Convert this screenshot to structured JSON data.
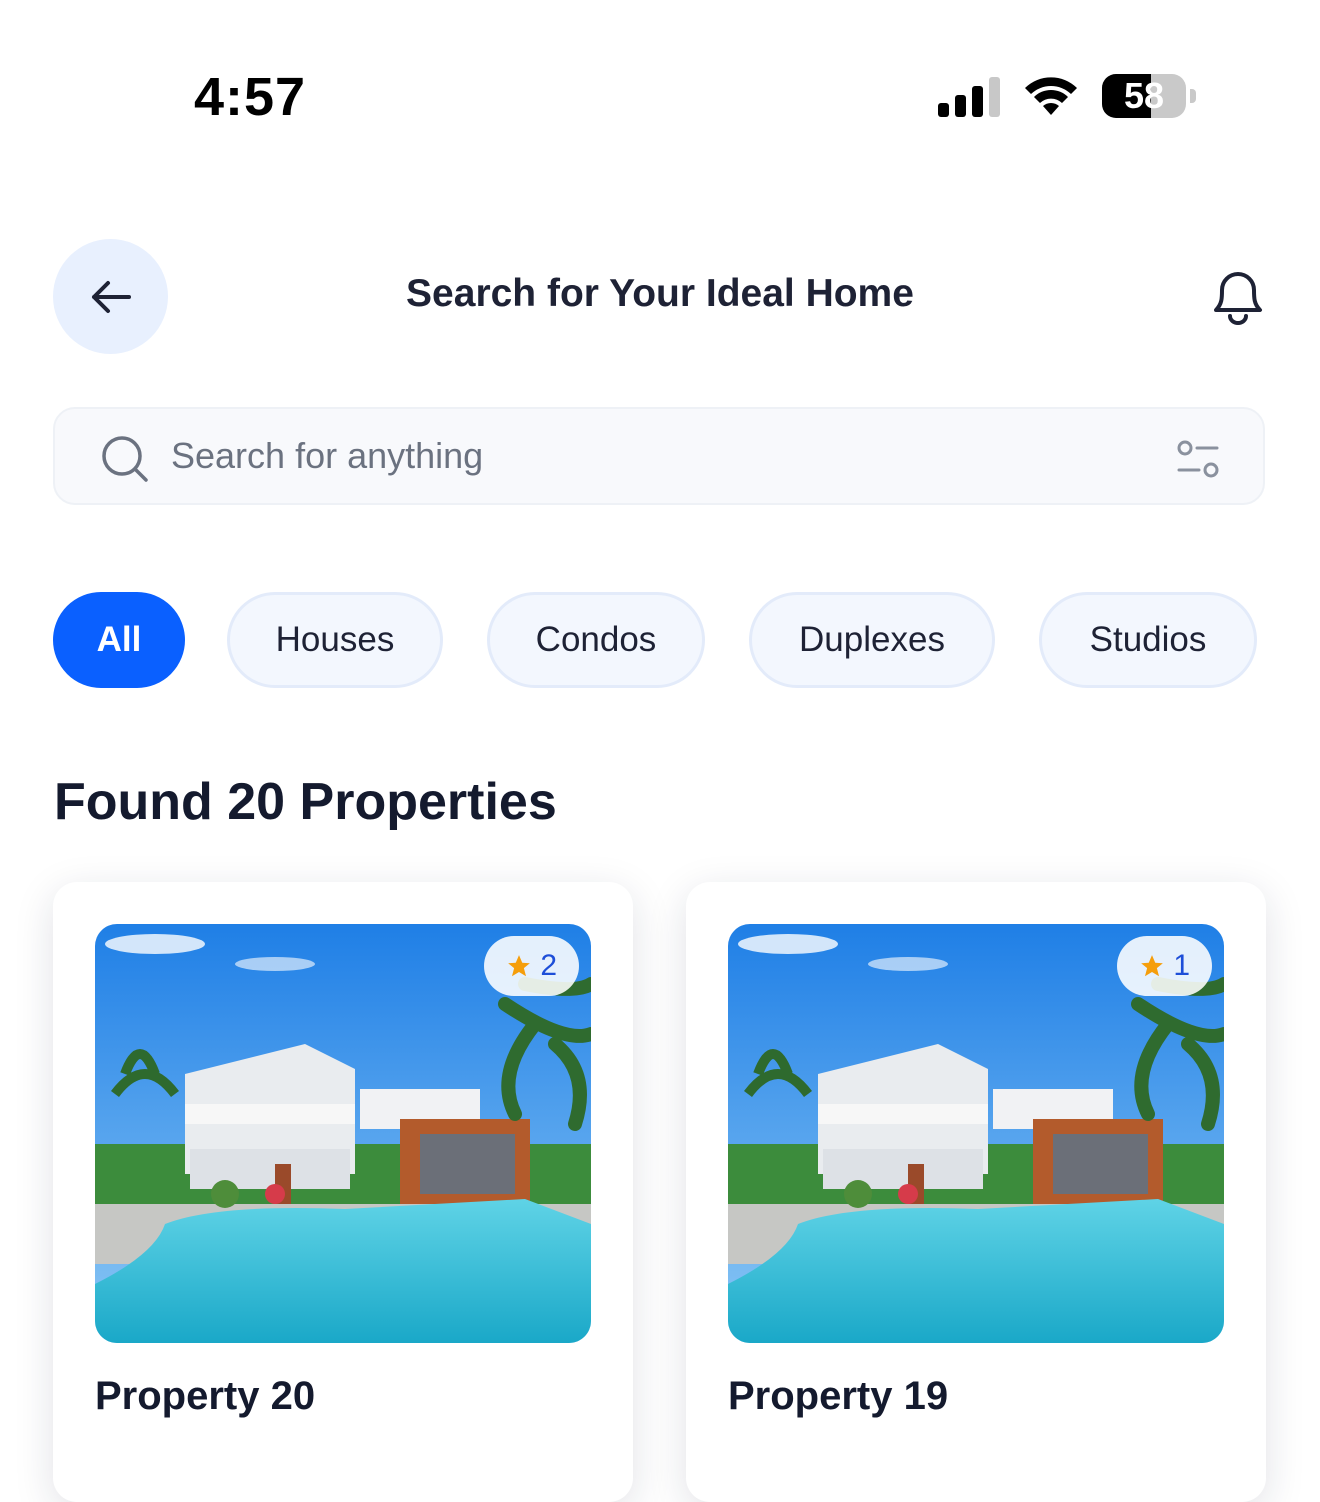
{
  "status": {
    "time": "4:57",
    "battery": "58"
  },
  "header": {
    "title": "Search for Your Ideal Home"
  },
  "search": {
    "placeholder": "Search for anything"
  },
  "filters": [
    "All",
    "Houses",
    "Condos",
    "Duplexes",
    "Studios"
  ],
  "results": {
    "heading": "Found 20 Properties"
  },
  "cards": [
    {
      "title": "Property 20",
      "rating": "2"
    },
    {
      "title": "Property 19",
      "rating": "1"
    }
  ],
  "colors": {
    "accent": "#0a60ff",
    "star": "#f59e0b",
    "chip_bg": "#f3f7fe"
  }
}
